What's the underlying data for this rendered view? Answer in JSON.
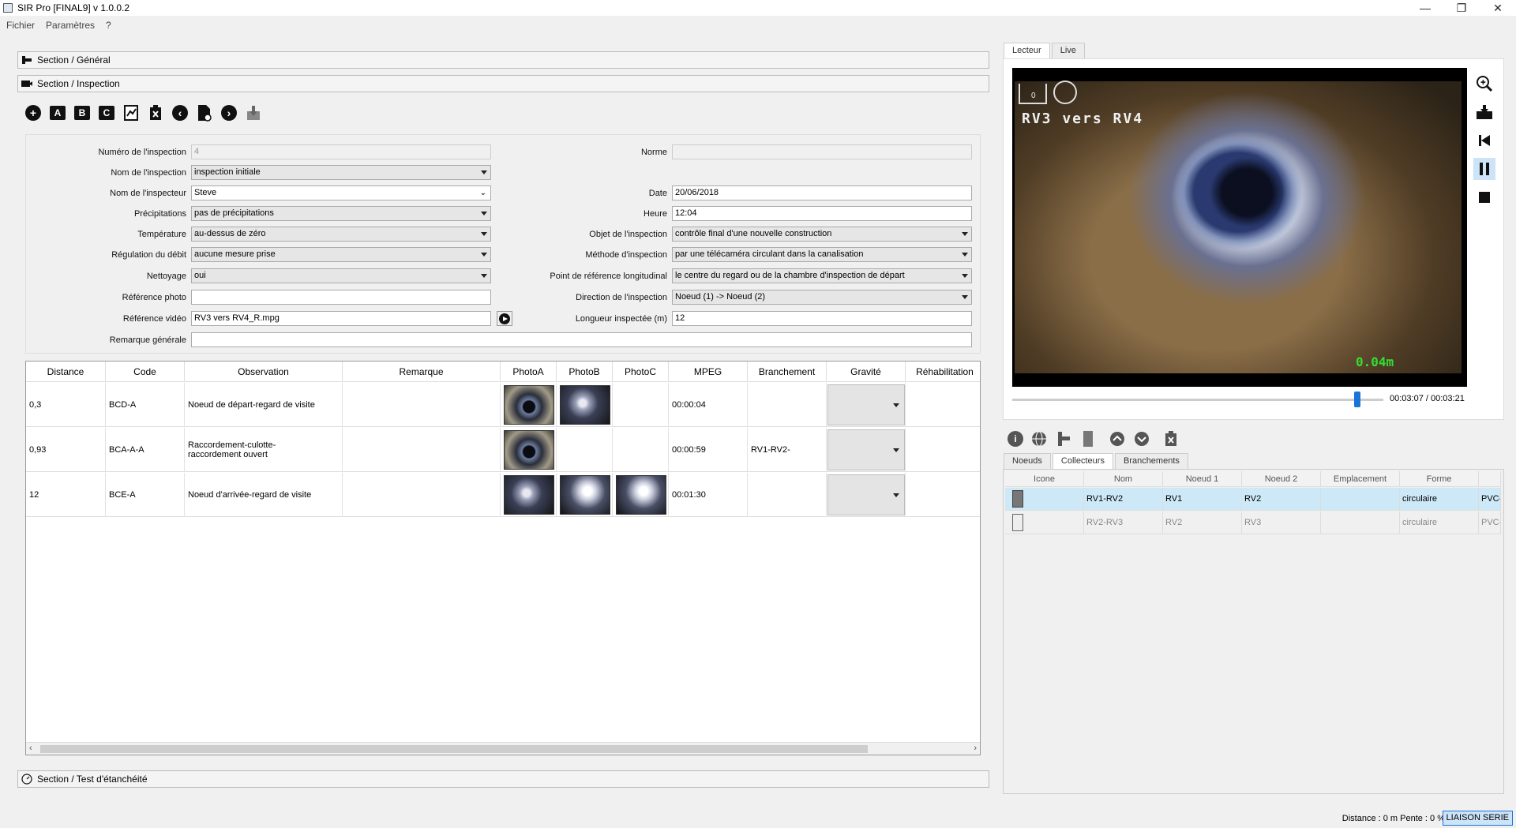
{
  "app": {
    "title": "SIR Pro [FINAL9]    v 1.0.0.2",
    "window_controls": {
      "minimize": "—",
      "restore": "❐",
      "close": "✕"
    }
  },
  "menu": [
    "Fichier",
    "Paramètres",
    "?"
  ],
  "sections": {
    "general": "Section / Général",
    "inspection": "Section / Inspection",
    "test": "Section / Test d'étanchéité"
  },
  "toolbar": {
    "add": "+",
    "a": "A",
    "b": "B",
    "c": "C",
    "prev": "‹",
    "next": "›"
  },
  "form": {
    "numero_label": "Numéro de l'inspection",
    "numero_value": "4",
    "nom_label": "Nom de l'inspection",
    "nom_value": "inspection initiale",
    "inspecteur_label": "Nom de l'inspecteur",
    "inspecteur_value": "Steve",
    "precip_label": "Précipitations",
    "precip_value": "pas de précipitations",
    "temp_label": "Température",
    "temp_value": "au-dessus de zéro",
    "regul_label": "Régulation du débit",
    "regul_value": "aucune mesure prise",
    "nettoyage_label": "Nettoyage",
    "nettoyage_value": "oui",
    "refphoto_label": "Référence photo",
    "refphoto_value": "",
    "refvideo_label": "Référence vidéo",
    "refvideo_value": "RV3 vers RV4_R.mpg",
    "remarque_label": "Remarque générale",
    "remarque_value": "",
    "norme_label": "Norme",
    "norme_value": "",
    "date_label": "Date",
    "date_value": "20/06/2018",
    "heure_label": "Heure",
    "heure_value": "12:04",
    "objet_label": "Objet de l'inspection",
    "objet_value": "contrôle final d'une nouvelle construction",
    "methode_label": "Méthode d'inspection",
    "methode_value": "par une télécaméra circulant dans la canalisation",
    "pointref_label": "Point de référence longitudinal",
    "pointref_value": "le centre du regard ou de la chambre d'inspection de départ",
    "direction_label": "Direction de l'inspection",
    "direction_value": "Noeud (1) -> Noeud (2)",
    "longueur_label": "Longueur inspectée (m)",
    "longueur_value": "12"
  },
  "table": {
    "headers": [
      "Distance",
      "Code",
      "Observation",
      "Remarque",
      "PhotoA",
      "PhotoB",
      "PhotoC",
      "MPEG",
      "Branchement",
      "Gravité",
      "Réhabilitation"
    ],
    "rows": [
      {
        "distance": "0,3",
        "code": "BCD-A",
        "observation": "Noeud de départ-regard de visite",
        "remarque": "",
        "mpeg": "00:00:04",
        "branchement": ""
      },
      {
        "distance": "0,93",
        "code": "BCA-A-A",
        "observation": "Raccordement-culotte-raccordement ouvert",
        "remarque": "",
        "mpeg": "00:00:59",
        "branchement": "RV1-RV2-"
      },
      {
        "distance": "12",
        "code": "BCE-A",
        "observation": "Noeud d'arrivée-regard de visite",
        "remarque": "",
        "mpeg": "00:01:30",
        "branchement": ""
      }
    ]
  },
  "player": {
    "tabs": [
      "Lecteur",
      "Live"
    ],
    "osd_title": "RV3 vers RV4",
    "osd_distance": "0.04m",
    "osd_counter": "0",
    "time": "00:03:07 / 00:03:21",
    "progress": 0.93
  },
  "lists": {
    "tabs": [
      "Noeuds",
      "Collecteurs",
      "Branchements"
    ],
    "headers": [
      "Icone",
      "Nom",
      "Noeud 1",
      "Noeud 2",
      "Emplacement",
      "Forme",
      ""
    ],
    "rows": [
      {
        "nom": "RV1-RV2",
        "n1": "RV1",
        "n2": "RV2",
        "empl": "",
        "forme": "circulaire",
        "mat": "PVC-"
      },
      {
        "nom": "RV2-RV3",
        "n1": "RV2",
        "n2": "RV3",
        "empl": "",
        "forme": "circulaire",
        "mat": "PVC-"
      }
    ]
  },
  "status": {
    "text": "Distance : 0 m   Pente : 0 %",
    "liaison": "LIAISON SERIE"
  }
}
